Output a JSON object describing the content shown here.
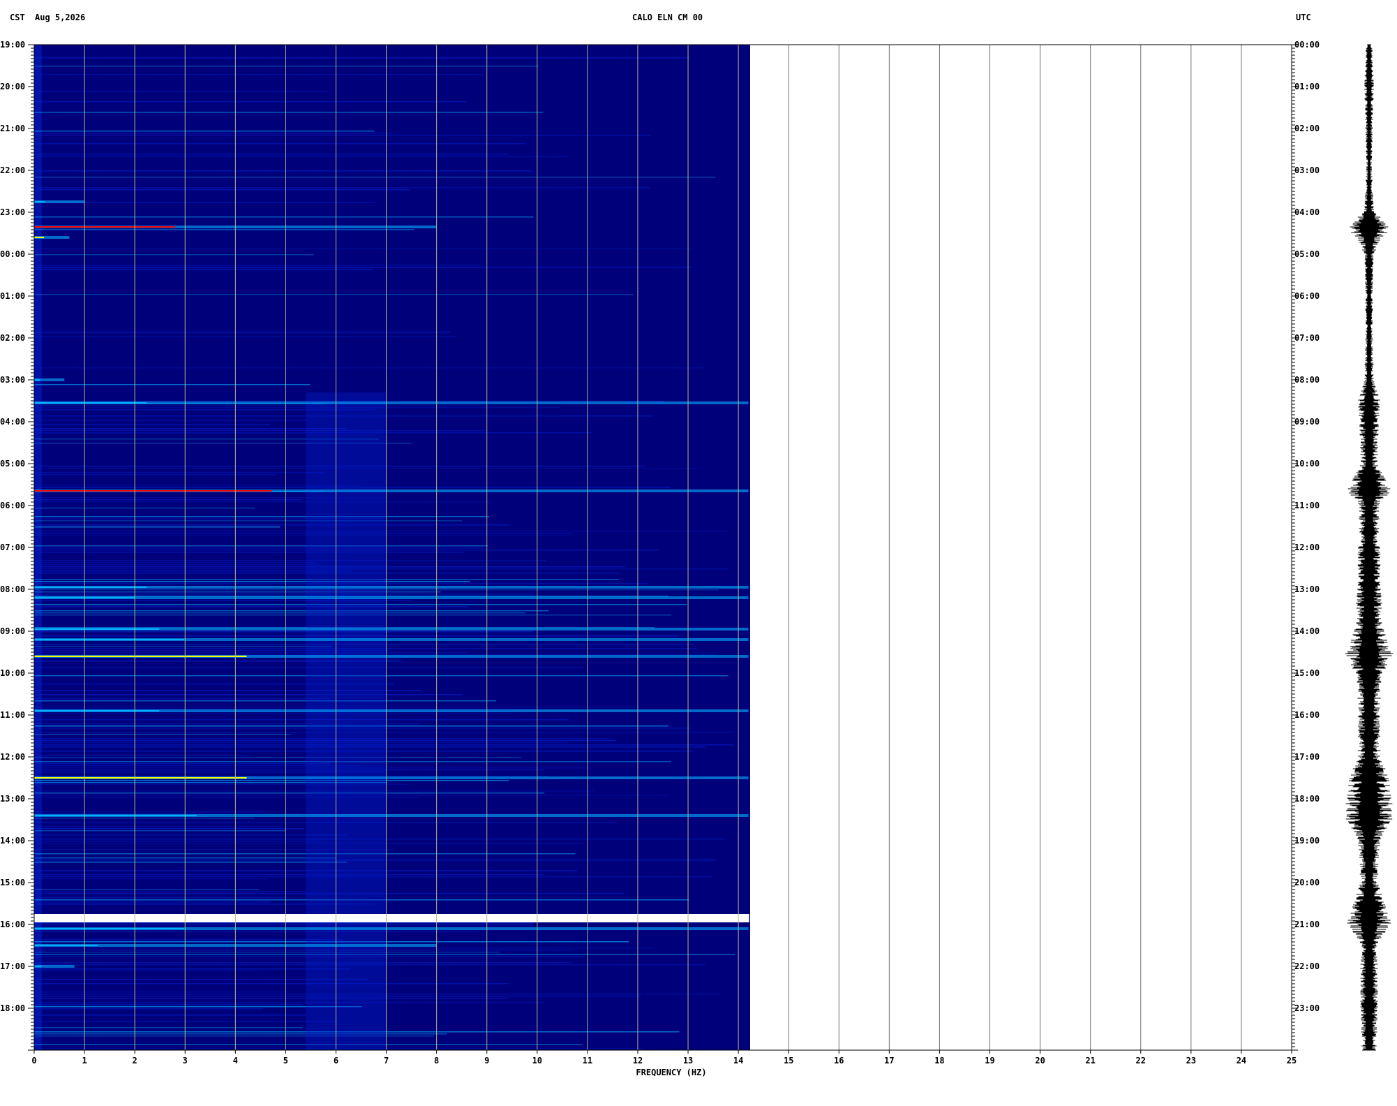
{
  "header": {
    "left_tz": "CST",
    "date": "Aug 5,2026",
    "station": "CALO ELN CM 00",
    "right_tz": "UTC"
  },
  "chart_data": {
    "type": "heatmap",
    "title": "CALO ELN CM 00",
    "xlabel": "FREQUENCY (HZ)",
    "ylabel": "",
    "xlim": [
      0,
      25
    ],
    "x_ticks": [
      "0",
      "1",
      "2",
      "3",
      "4",
      "5",
      "6",
      "7",
      "8",
      "9",
      "10",
      "11",
      "12",
      "13",
      "14",
      "15",
      "16",
      "17",
      "18",
      "19",
      "20",
      "21",
      "22",
      "23",
      "24",
      "25"
    ],
    "spectrogram_freq_max_hz": 14.2,
    "time_span_hours": 24,
    "left_axis_times": [
      "19:00",
      "20:00",
      "21:00",
      "22:00",
      "23:00",
      "00:00",
      "01:00",
      "02:00",
      "03:00",
      "04:00",
      "05:00",
      "06:00",
      "07:00",
      "08:00",
      "09:00",
      "10:00",
      "11:00",
      "12:00",
      "13:00",
      "14:00",
      "15:00",
      "16:00",
      "17:00",
      "18:00"
    ],
    "right_axis_times": [
      "00:00",
      "01:00",
      "02:00",
      "03:00",
      "04:00",
      "05:00",
      "06:00",
      "07:00",
      "08:00",
      "09:00",
      "10:00",
      "11:00",
      "12:00",
      "13:00",
      "14:00",
      "15:00",
      "16:00",
      "17:00",
      "18:00",
      "19:00",
      "20:00",
      "21:00",
      "22:00",
      "23:00"
    ],
    "data_gap_hours": [
      20.75,
      20.95
    ],
    "events": [
      {
        "hour": 3.75,
        "fmax": 1.0,
        "level": 0.6
      },
      {
        "hour": 4.35,
        "fmax": 8.0,
        "level": 1.0
      },
      {
        "hour": 4.6,
        "fmax": 0.7,
        "level": 0.8
      },
      {
        "hour": 8.0,
        "fmax": 0.6,
        "level": 0.5
      },
      {
        "hour": 8.55,
        "fmax": 14.2,
        "level": 0.45
      },
      {
        "hour": 10.65,
        "fmax": 14.2,
        "level": 0.95
      },
      {
        "hour": 12.95,
        "fmax": 14.2,
        "level": 0.45
      },
      {
        "hour": 13.2,
        "fmax": 14.2,
        "level": 0.4
      },
      {
        "hour": 13.95,
        "fmax": 14.2,
        "level": 0.5
      },
      {
        "hour": 14.2,
        "fmax": 14.2,
        "level": 0.6
      },
      {
        "hour": 14.6,
        "fmax": 14.2,
        "level": 0.85
      },
      {
        "hour": 15.9,
        "fmax": 14.2,
        "level": 0.5
      },
      {
        "hour": 17.5,
        "fmax": 14.2,
        "level": 0.85
      },
      {
        "hour": 18.4,
        "fmax": 14.2,
        "level": 0.65
      },
      {
        "hour": 21.1,
        "fmax": 14.2,
        "level": 0.6
      },
      {
        "hour": 21.5,
        "fmax": 8.0,
        "level": 0.45
      },
      {
        "hour": 22.0,
        "fmax": 0.8,
        "level": 0.5
      }
    ],
    "seismogram_activity": [
      {
        "hour": 0.0,
        "amp": 0.12
      },
      {
        "hour": 1.0,
        "amp": 0.2
      },
      {
        "hour": 2.0,
        "amp": 0.15
      },
      {
        "hour": 3.0,
        "amp": 0.12
      },
      {
        "hour": 4.0,
        "amp": 0.2
      },
      {
        "hour": 4.35,
        "amp": 1.0
      },
      {
        "hour": 4.6,
        "amp": 0.5
      },
      {
        "hour": 5.0,
        "amp": 0.2
      },
      {
        "hour": 6.0,
        "amp": 0.15
      },
      {
        "hour": 7.0,
        "amp": 0.15
      },
      {
        "hour": 8.0,
        "amp": 0.2
      },
      {
        "hour": 8.5,
        "amp": 0.45
      },
      {
        "hour": 9.0,
        "amp": 0.4
      },
      {
        "hour": 10.0,
        "amp": 0.35
      },
      {
        "hour": 10.65,
        "amp": 0.9
      },
      {
        "hour": 11.0,
        "amp": 0.4
      },
      {
        "hour": 12.0,
        "amp": 0.45
      },
      {
        "hour": 13.0,
        "amp": 0.5
      },
      {
        "hour": 14.0,
        "amp": 0.6
      },
      {
        "hour": 14.6,
        "amp": 1.0
      },
      {
        "hour": 15.0,
        "amp": 0.55
      },
      {
        "hour": 16.0,
        "amp": 0.45
      },
      {
        "hour": 17.0,
        "amp": 0.45
      },
      {
        "hour": 17.5,
        "amp": 0.8
      },
      {
        "hour": 18.4,
        "amp": 1.0
      },
      {
        "hour": 19.0,
        "amp": 0.45
      },
      {
        "hour": 20.0,
        "amp": 0.35
      },
      {
        "hour": 20.95,
        "amp": 0.9
      },
      {
        "hour": 21.5,
        "amp": 0.3
      },
      {
        "hour": 22.0,
        "amp": 0.35
      },
      {
        "hour": 23.0,
        "amp": 0.35
      },
      {
        "hour": 24.0,
        "amp": 0.3
      }
    ],
    "colors": {
      "background": "#00007a",
      "low": "#0020d0",
      "mid": "#00b0ff",
      "high": "#ffff00",
      "peak": "#ff0000",
      "gridline": "#b8b48c",
      "trace": "#000000"
    }
  }
}
